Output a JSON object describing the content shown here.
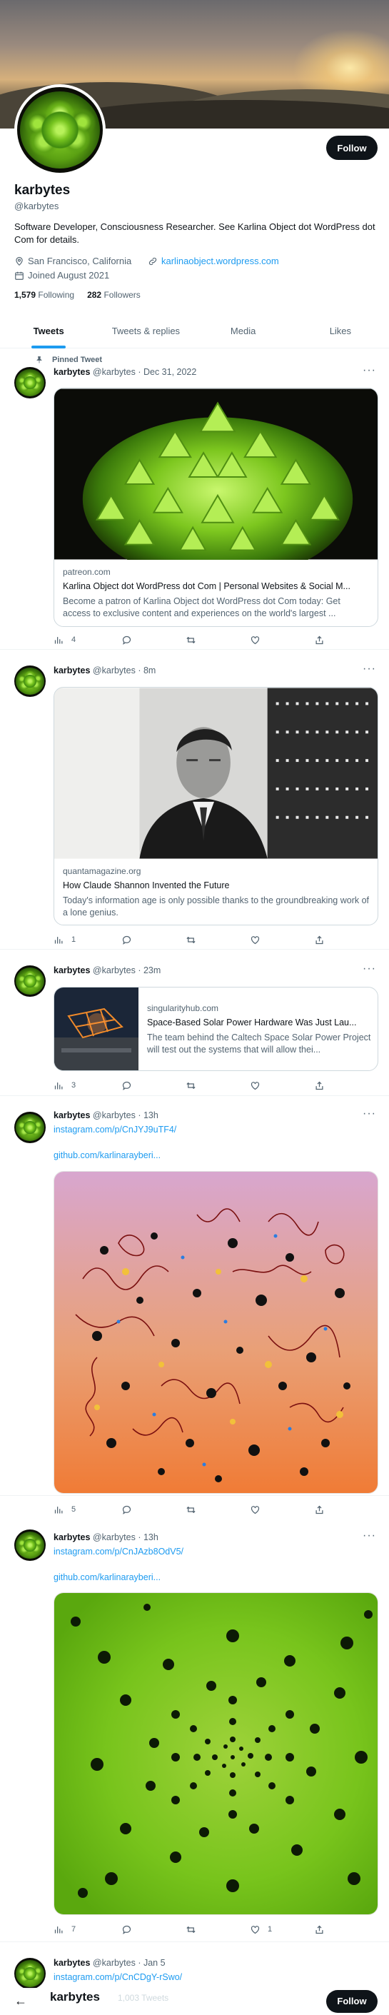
{
  "profile": {
    "name": "karbytes",
    "handle": "@karbytes",
    "bio": "Software Developer, Consciousness Researcher. See Karlina Object dot WordPress dot Com for details.",
    "location": "San Francisco, California",
    "website": "karlinaobject.wordpress.com",
    "joined": "Joined August 2021",
    "following_count": "1,579",
    "following_label": "Following",
    "followers_count": "282",
    "followers_label": "Followers",
    "follow_label": "Follow"
  },
  "tabs": [
    {
      "label": "Tweets",
      "active": true
    },
    {
      "label": "Tweets & replies",
      "active": false
    },
    {
      "label": "Media",
      "active": false
    },
    {
      "label": "Likes",
      "active": false
    }
  ],
  "tweets": [
    {
      "pinned_label": "Pinned Tweet",
      "name": "karbytes",
      "meta": "@karbytes · Dec 31, 2022",
      "card": {
        "domain": "patreon.com",
        "title": "Karlina Object dot WordPress dot Com | Personal Websites & Social M...",
        "description": "Become a patron of Karlina Object dot WordPress dot Com today: Get access to exclusive content and experiences on the world's largest ..."
      },
      "stats": {
        "views": "4",
        "replies": "",
        "retweets": "",
        "likes": ""
      }
    },
    {
      "name": "karbytes",
      "meta": "@karbytes · 8m",
      "card": {
        "domain": "quantamagazine.org",
        "title": "How Claude Shannon Invented the Future",
        "description": "Today's information age is only possible thanks to the groundbreaking work of a lone genius."
      },
      "stats": {
        "views": "1",
        "replies": "",
        "retweets": "",
        "likes": ""
      }
    },
    {
      "name": "karbytes",
      "meta": "@karbytes · 23m",
      "card": {
        "domain": "singularityhub.com",
        "title": "Space-Based Solar Power Hardware Was Just Lau...",
        "description": "The team behind the Caltech Space Solar Power Project will test out the systems that will allow thei..."
      },
      "stats": {
        "views": "3",
        "replies": "",
        "retweets": "",
        "likes": ""
      }
    },
    {
      "name": "karbytes",
      "meta": "@karbytes · 13h",
      "link1": "instagram.com/p/CnJYJ9uTF4/",
      "link2": "github.com/karlinarayberi...",
      "stats": {
        "views": "5",
        "replies": "",
        "retweets": "",
        "likes": ""
      }
    },
    {
      "name": "karbytes",
      "meta": "@karbytes · 13h",
      "link1": "instagram.com/p/CnJAzb8OdV5/",
      "link2": "github.com/karlinarayberi...",
      "stats": {
        "views": "7",
        "replies": "",
        "retweets": "",
        "likes": "1"
      }
    },
    {
      "name": "karbytes",
      "meta": "@karbytes · Jan 5",
      "link1": "instagram.com/p/CnCDgY-rSwo/"
    }
  ],
  "sticky": {
    "back_glyph": "←",
    "name": "karbytes",
    "count": "1,003 Tweets",
    "follow_label": "Follow"
  },
  "colors": {
    "accent": "#1d9bf0",
    "text": "#0f1419",
    "muted": "#536471",
    "border": "#cfd9de"
  }
}
